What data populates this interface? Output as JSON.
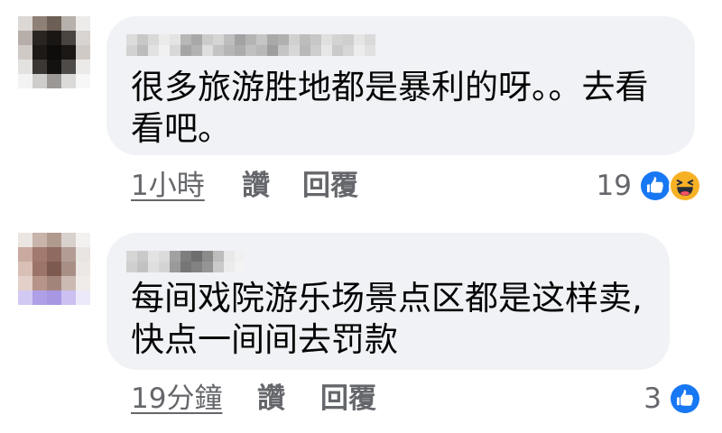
{
  "comments": [
    {
      "text_lines": [
        "很多旅游胜地都是暴利的呀。。去看",
        "看吧。"
      ],
      "time": "1小時",
      "like_label": "讚",
      "reply_label": "回覆",
      "reaction_count": 19,
      "reactions": [
        "like-icon",
        "haha-icon"
      ]
    },
    {
      "text_lines": [
        "每间戏院游乐场景点区都是这样卖,",
        "快点一间间去罚款"
      ],
      "time": "19分鐘",
      "like_label": "讚",
      "reply_label": "回覆",
      "reaction_count": 3,
      "reactions": [
        "like-icon"
      ]
    }
  ],
  "colors": {
    "bubble": "#f0f2f5",
    "text": "#050505",
    "meta_text": "#65676b",
    "like_blue": "#1877f2",
    "haha_yellow": "#f7b125"
  }
}
